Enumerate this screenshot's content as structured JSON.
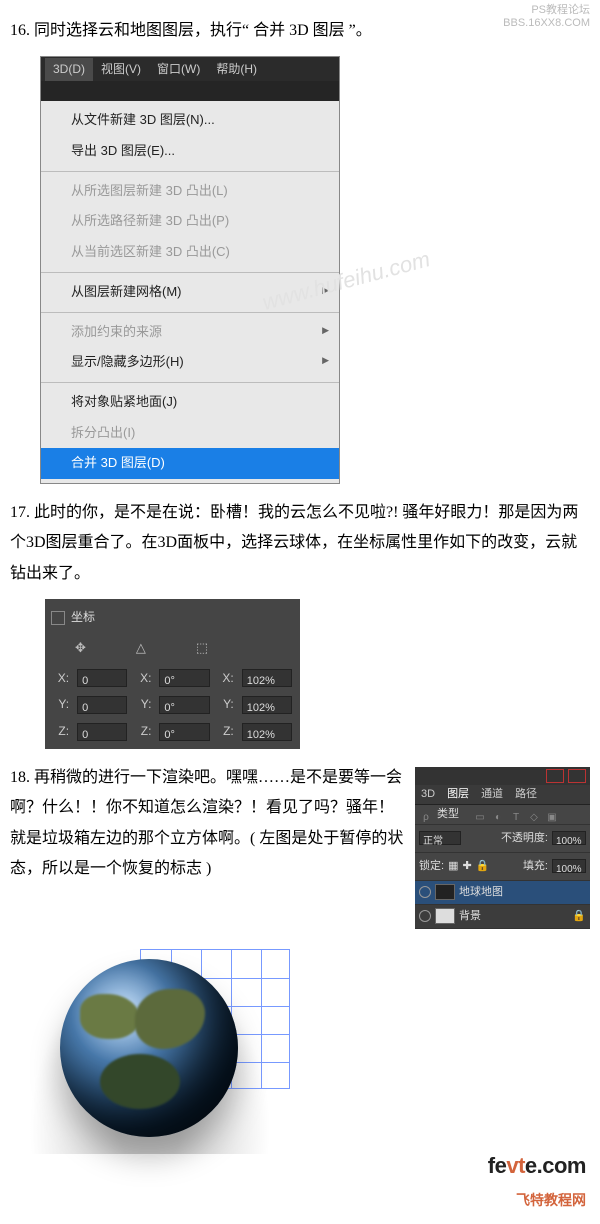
{
  "watermarks": {
    "top_line1": "PS教程论坛",
    "top_line2": "BBS.16XX8.COM",
    "body": "www.hufeihu.com"
  },
  "step16": {
    "text": "16. 同时选择云和地图图层，执行“ 合并 3D 图层 ”。"
  },
  "menu": {
    "bar": [
      "3D(D)",
      "视图(V)",
      "窗口(W)",
      "帮助(H)"
    ],
    "bar_selected_index": 0,
    "groups": [
      [
        {
          "label": "从文件新建 3D 图层(N)...",
          "disabled": false
        },
        {
          "label": "导出 3D 图层(E)...",
          "disabled": false
        }
      ],
      [
        {
          "label": "从所选图层新建 3D 凸出(L)",
          "disabled": true
        },
        {
          "label": "从所选路径新建 3D 凸出(P)",
          "disabled": true
        },
        {
          "label": "从当前选区新建 3D 凸出(C)",
          "disabled": true
        }
      ],
      [
        {
          "label": "从图层新建网格(M)",
          "disabled": false,
          "arrow": true
        }
      ],
      [
        {
          "label": "添加约束的来源",
          "disabled": true,
          "arrow": true
        },
        {
          "label": "显示/隐藏多边形(H)",
          "disabled": false,
          "arrow": true
        }
      ],
      [
        {
          "label": "将对象贴紧地面(J)",
          "disabled": false
        },
        {
          "label": "拆分凸出(I)",
          "disabled": true
        },
        {
          "label": "合并 3D 图层(D)",
          "highlight": true
        }
      ]
    ]
  },
  "step17": {
    "text": "17. 此时的你，是不是在说：卧槽！我的云怎么不见啦?! 骚年好眼力！那是因为两个3D图层重合了。在3D面板中，选择云球体，在坐标属性里作如下的改变，云就钻出来了。"
  },
  "coords": {
    "title": "坐标",
    "header_icons": [
      "move-icon",
      "rotate-icon",
      "scale-icon"
    ],
    "rows": [
      {
        "label": "X:",
        "pos": "0",
        "rot_label": "X:",
        "rot": "0°",
        "scale_label": "X:",
        "scale": "102%"
      },
      {
        "label": "Y:",
        "pos": "0",
        "rot_label": "Y:",
        "rot": "0°",
        "scale_label": "Y:",
        "scale": "102%"
      },
      {
        "label": "Z:",
        "pos": "0",
        "rot_label": "Z:",
        "rot": "0°",
        "scale_label": "Z:",
        "scale": "102%"
      }
    ]
  },
  "step18": {
    "text": "18. 再稍微的进行一下渲染吧。嘿嘿……是不是要等一会啊？什么！！你不知道怎么渲染？！看见了吗？骚年！就是垃圾箱左边的那个立方体啊。( 左图是处于暂停的状态，所以是一个恢复的标志 )"
  },
  "layers": {
    "tabs": [
      "3D",
      "图层",
      "通道",
      "路径"
    ],
    "active_tab_index": 1,
    "filter_label": "类型",
    "mode": "正常",
    "opacity_label": "不透明度:",
    "opacity_value": "100%",
    "lock_label": "锁定:",
    "fill_label": "填充:",
    "fill_value": "100%",
    "items": [
      {
        "name": "地球地图",
        "selected": true
      },
      {
        "name": "背景",
        "selected": false,
        "locked": true
      }
    ]
  },
  "footer": {
    "brand_prefix": "fe",
    "brand_mid": "vt",
    "brand_suffix": "e",
    "brand_tld": ".com",
    "tagline": "飞特教程网"
  }
}
